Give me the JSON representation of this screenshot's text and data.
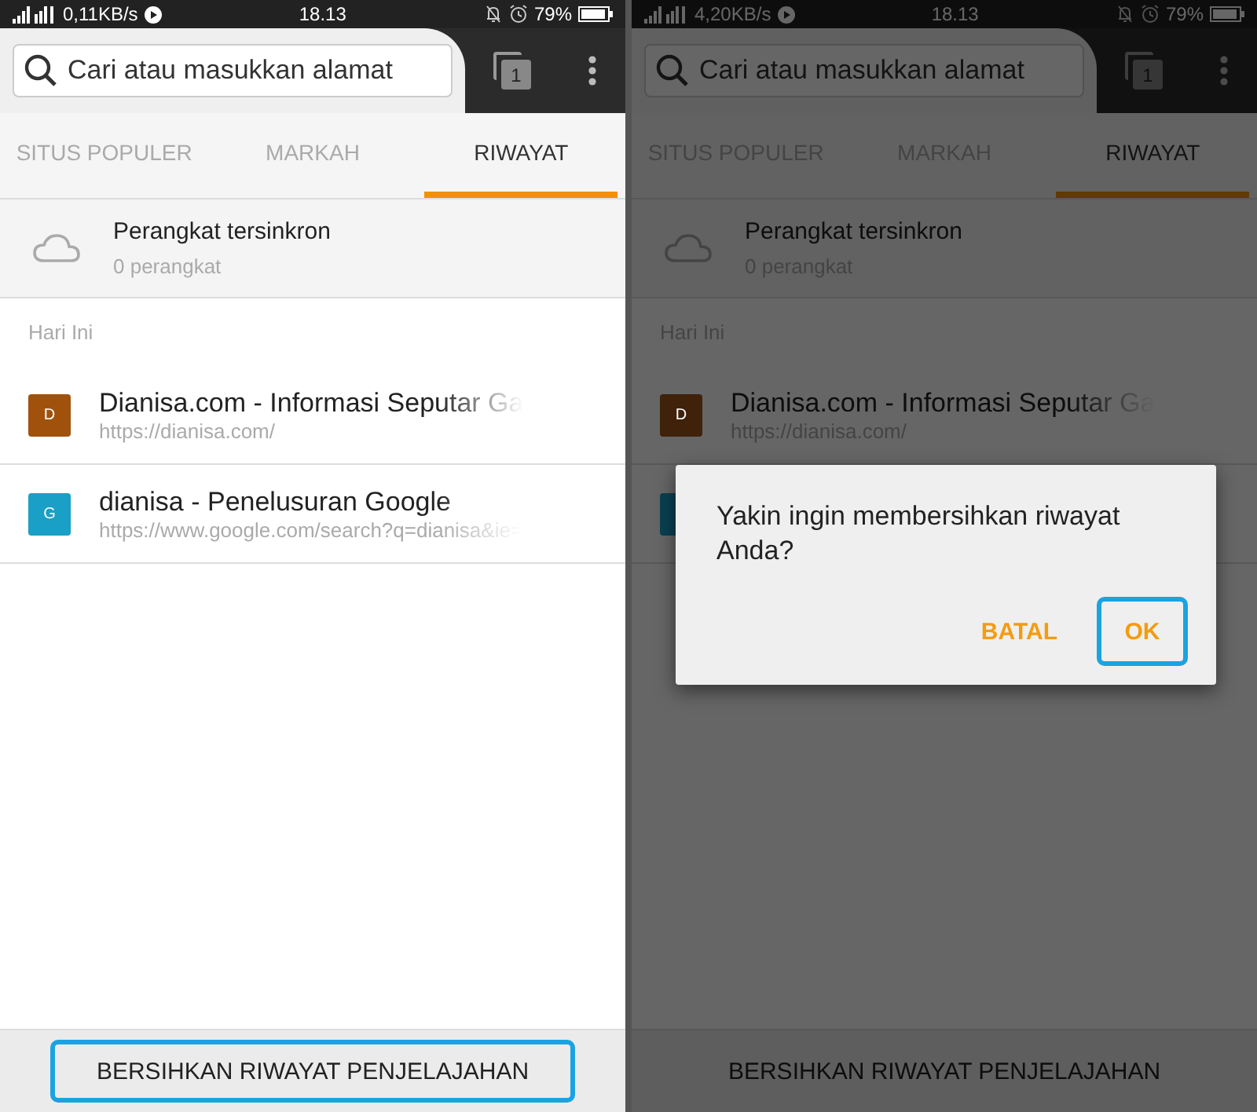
{
  "panels": [
    {
      "status_bar": {
        "speed": "0,11KB/s",
        "time": "18.13",
        "battery": "79%"
      },
      "toolbar": {
        "search": {
          "placeholder": "Cari atau masukkan alamat"
        },
        "tab_count": "1"
      },
      "tabs": [
        {
          "label": "SITUS POPULER",
          "selected": false
        },
        {
          "label": "MARKAH",
          "selected": false
        },
        {
          "label": "RIWAYAT",
          "selected": true
        }
      ],
      "synced": {
        "title": "Perangkat tersinkron",
        "subtitle": "0 perangkat"
      },
      "section": "Hari Ini",
      "rows": [
        {
          "letter": "D",
          "color": "#a0520d",
          "title": "Dianisa.com - Informasi Seputar Ga",
          "url": "https://dianisa.com/"
        },
        {
          "letter": "G",
          "color": "#1a9fc6",
          "title": "dianisa - Penelusuran Google",
          "url": "https://www.google.com/search?q=dianisa&ie="
        }
      ],
      "footer_button": {
        "label": "BERSIHKAN RIWAYAT PENJELAJAHAN",
        "highlighted": true
      }
    },
    {
      "status_bar": {
        "speed": "4,20KB/s",
        "time": "18.13",
        "battery": "79%"
      },
      "toolbar": {
        "search": {
          "placeholder": "Cari atau masukkan alamat"
        },
        "tab_count": "1"
      },
      "tabs": [
        {
          "label": "SITUS POPULER",
          "selected": false
        },
        {
          "label": "MARKAH",
          "selected": false
        },
        {
          "label": "RIWAYAT",
          "selected": true
        }
      ],
      "synced": {
        "title": "Perangkat tersinkron",
        "subtitle": "0 perangkat"
      },
      "section": "Hari Ini",
      "rows": [
        {
          "letter": "D",
          "color": "#40210a",
          "title": "Dianisa.com - Informasi Seputar Ga",
          "url": "https://dianisa.com/"
        },
        {
          "color": "#0a4050"
        }
      ],
      "footer_button": {
        "label": "BERSIHKAN RIWAYAT PENJELAJAHAN",
        "highlighted": false
      },
      "dialog": {
        "message": "Yakin ingin membersihkan riwayat Anda?",
        "buttons": [
          {
            "label": "BATAL",
            "highlighted": false
          },
          {
            "label": "OK",
            "highlighted": true
          }
        ]
      }
    }
  ]
}
